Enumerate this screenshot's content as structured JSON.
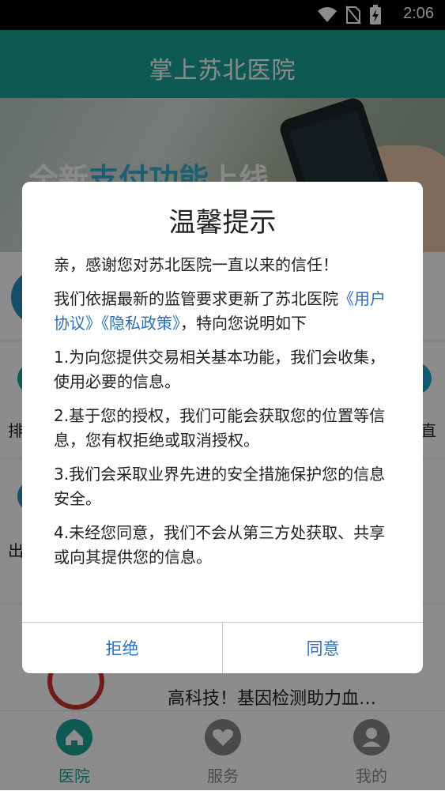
{
  "status_bar": {
    "time": "2:06"
  },
  "app_title": "掌上苏北医院",
  "banner": {
    "slogan_prefix": "全新",
    "slogan_highlight": "支付功能",
    "slogan_suffix": "上线"
  },
  "background": {
    "left_label_1": "排",
    "left_label_2": "出",
    "right_label_1": "直",
    "news_title": "高科技！基因检测助力血…"
  },
  "tabs": [
    {
      "label": "医院",
      "active": true
    },
    {
      "label": "服务",
      "active": false
    },
    {
      "label": "我的",
      "active": false
    }
  ],
  "dialog": {
    "title": "温馨提示",
    "para1": "亲，感谢您对苏北医院一直以来的信任！",
    "para2_prefix": "我们依据最新的监管要求更新了苏北医院",
    "user_agreement": "《用户协议》",
    "privacy_policy": "《隐私政策》",
    "para2_suffix": "，特向您说明如下",
    "item1": "1.为向您提供交易相关基本功能，我们会收集，使用必要的信息。",
    "item2": "2.基于您的授权，我们可能会获取您的位置等信息，您有权拒绝或取消授权。",
    "item3": "3.我们会采取业界先进的安全措施保护您的信息安全。",
    "item4": "4.未经您同意，我们不会从第三方处获取、共享或向其提供您的信息。",
    "reject_label": "拒绝",
    "agree_label": "同意"
  },
  "colors": {
    "primary": "#1aa597",
    "link": "#2f6fb4",
    "tab_active": "#1aa597",
    "tab_inactive": "#888888"
  }
}
